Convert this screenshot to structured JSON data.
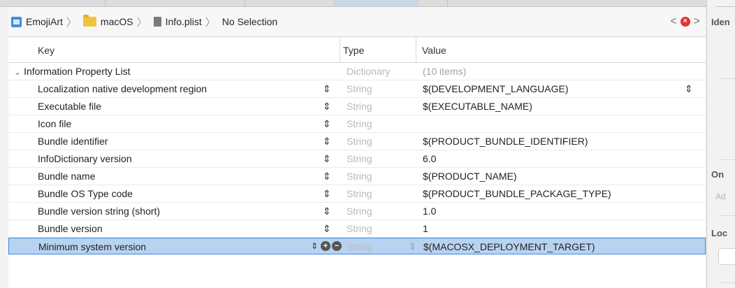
{
  "jumpbar": {
    "crumbs": [
      "EmojiArt",
      "macOS",
      "Info.plist",
      "No Selection"
    ]
  },
  "columns": {
    "key": "Key",
    "type": "Type",
    "value": "Value"
  },
  "root": {
    "key": "Information Property List",
    "type": "Dictionary",
    "value": "(10 items)"
  },
  "rows": [
    {
      "key": "Localization native development region",
      "type": "String",
      "value": "$(DEVELOPMENT_LANGUAGE)"
    },
    {
      "key": "Executable file",
      "type": "String",
      "value": "$(EXECUTABLE_NAME)"
    },
    {
      "key": "Icon file",
      "type": "String",
      "value": ""
    },
    {
      "key": "Bundle identifier",
      "type": "String",
      "value": "$(PRODUCT_BUNDLE_IDENTIFIER)"
    },
    {
      "key": "InfoDictionary version",
      "type": "String",
      "value": "6.0"
    },
    {
      "key": "Bundle name",
      "type": "String",
      "value": "$(PRODUCT_NAME)"
    },
    {
      "key": "Bundle OS Type code",
      "type": "String",
      "value": "$(PRODUCT_BUNDLE_PACKAGE_TYPE)"
    },
    {
      "key": "Bundle version string (short)",
      "type": "String",
      "value": "1.0"
    },
    {
      "key": "Bundle version",
      "type": "String",
      "value": "1"
    },
    {
      "key": "Minimum system version",
      "type": "String",
      "value": "$(MACOSX_DEPLOYMENT_TARGET)"
    }
  ],
  "icons": {
    "stepper": "⌃⌄",
    "add": "+",
    "remove": "−",
    "error": "×",
    "chevron_down": "⌄",
    "back": "<",
    "forward": ">"
  },
  "inspector": {
    "identity_label": "Iden",
    "on_label": "On",
    "add_placeholder": "Ad",
    "loc_label": "Loc"
  },
  "colors": {
    "selection": "#b7d3f1",
    "selection_border": "#3f87df",
    "error": "#e0362c",
    "folder": "#f3c33c"
  }
}
